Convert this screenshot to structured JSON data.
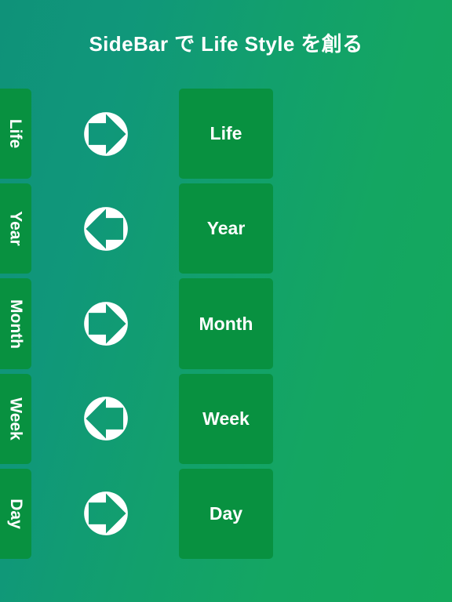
{
  "header": {
    "title": "SideBar で Life Style を創る"
  },
  "theme": {
    "background_from": "#0f9279",
    "background_to": "#14a95c",
    "panel_green": "#089140",
    "text_color": "#ffffff"
  },
  "sidebar": {
    "items": [
      {
        "label": "Life"
      },
      {
        "label": "Year"
      },
      {
        "label": "Month"
      },
      {
        "label": "Week"
      },
      {
        "label": "Day"
      }
    ]
  },
  "icons": {
    "items": [
      {
        "name": "circle-arrow-right-icon",
        "direction": "right"
      },
      {
        "name": "circle-arrow-left-icon",
        "direction": "left"
      },
      {
        "name": "circle-arrow-right-icon",
        "direction": "right"
      },
      {
        "name": "circle-arrow-left-icon",
        "direction": "left"
      },
      {
        "name": "circle-arrow-right-icon",
        "direction": "right"
      }
    ]
  },
  "cards": {
    "items": [
      {
        "label": "Life"
      },
      {
        "label": "Year"
      },
      {
        "label": "Month"
      },
      {
        "label": "Week"
      },
      {
        "label": "Day"
      }
    ]
  }
}
